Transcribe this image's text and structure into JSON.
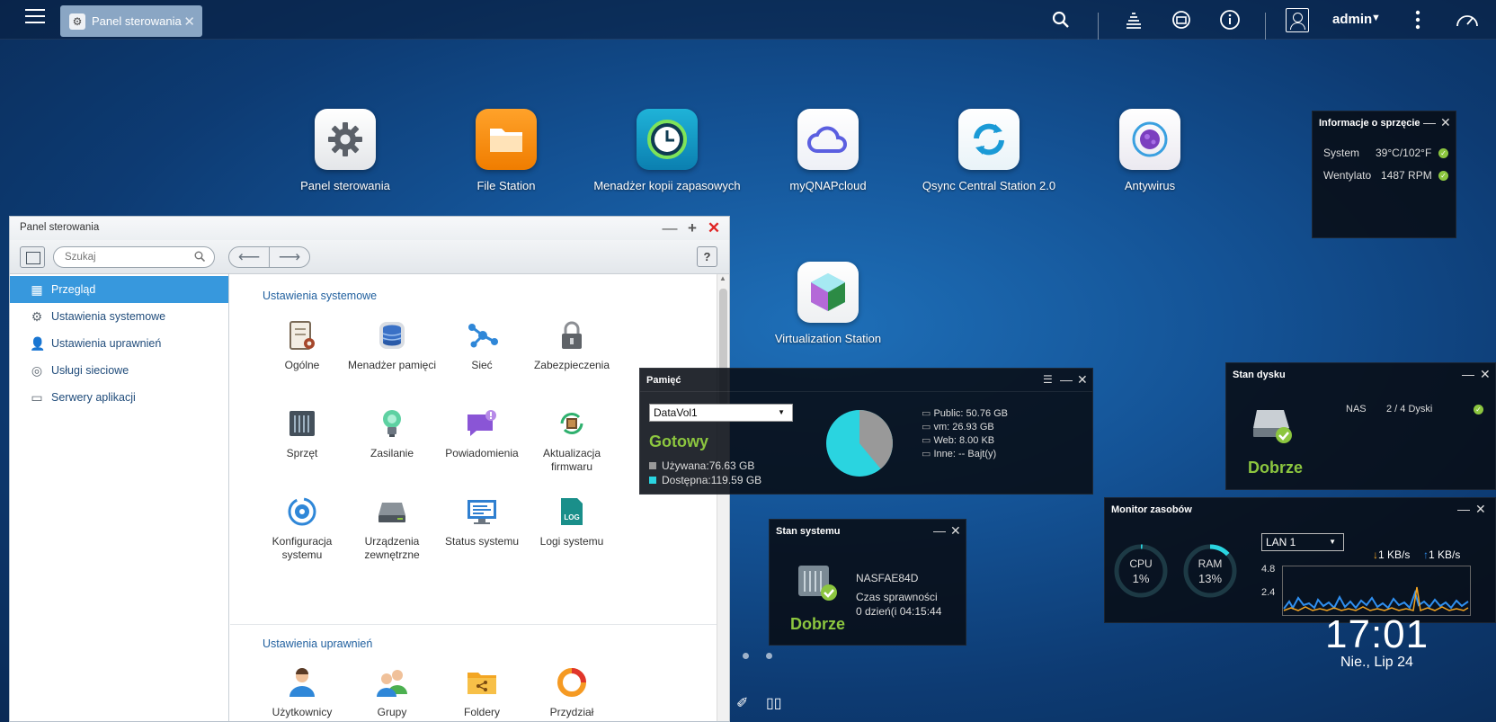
{
  "taskbar": {
    "tab_label": "Panel sterowania",
    "user": "admin"
  },
  "desktop": {
    "apps": [
      {
        "label": "Panel sterowania"
      },
      {
        "label": "File Station"
      },
      {
        "label": "Menadżer kopii zapasowych"
      },
      {
        "label": "myQNAPcloud"
      },
      {
        "label": "Qsync Central Station 2.0"
      },
      {
        "label": "Antywirus"
      },
      {
        "label": "Virtualization Station"
      }
    ]
  },
  "control_panel": {
    "title": "Panel sterowania",
    "search_placeholder": "Szukaj",
    "help": "?",
    "sidebar": [
      {
        "label": "Przegląd"
      },
      {
        "label": "Ustawienia systemowe"
      },
      {
        "label": "Ustawienia uprawnień"
      },
      {
        "label": "Usługi sieciowe"
      },
      {
        "label": "Serwery aplikacji"
      }
    ],
    "section1_title": "Ustawienia systemowe",
    "section1_items": [
      {
        "label": "Ogólne"
      },
      {
        "label": "Menadżer pamięci"
      },
      {
        "label": "Sieć"
      },
      {
        "label": "Zabezpieczenia"
      },
      {
        "label": "Sprzęt"
      },
      {
        "label": "Zasilanie"
      },
      {
        "label": "Powiadomienia"
      },
      {
        "label": "Aktualizacja firmwaru"
      },
      {
        "label": "Konfiguracja systemu"
      },
      {
        "label": "Urządzenia zewnętrzne"
      },
      {
        "label": "Status systemu"
      },
      {
        "label": "Logi systemu"
      }
    ],
    "section2_title": "Ustawienia uprawnień",
    "section2_items": [
      {
        "label": "Użytkownicy"
      },
      {
        "label": "Grupy użytkowników"
      },
      {
        "label": "Foldery współdzielone"
      },
      {
        "label": "Przydział"
      }
    ]
  },
  "hardware_widget": {
    "title": "Informacje o sprzęcie",
    "rows": [
      {
        "name": "System",
        "value": "39°C/102°F"
      },
      {
        "name": "Wentylato",
        "value": "1487 RPM"
      }
    ]
  },
  "memory_widget": {
    "title": "Pamięć",
    "volume": "DataVol1",
    "status": "Gotowy",
    "used": "Używana:76.63 GB",
    "free": "Dostępna:119.59 GB",
    "used_fraction": 0.39,
    "folders": [
      "Public: 50.76 GB",
      "vm: 26.93 GB",
      "Web: 8.00 KB",
      "Inne: -- Bajt(y)"
    ],
    "colors": {
      "used": "#999999",
      "free": "#2ad4e0"
    }
  },
  "system_widget": {
    "title": "Stan systemu",
    "status": "Dobrze",
    "hostname": "NASFAE84D",
    "uptime_label": "Czas sprawności",
    "uptime": "0 dzień(i 04:15:44"
  },
  "disk_widget": {
    "title": "Stan dysku",
    "status": "Dobrze",
    "name": "NAS",
    "disks": "2 / 4 Dyski"
  },
  "resource_widget": {
    "title": "Monitor zasobów",
    "cpu_label": "CPU",
    "cpu_value": "1%",
    "cpu_fraction": 0.01,
    "ram_label": "RAM",
    "ram_value": "13%",
    "ram_fraction": 0.13,
    "lan": "LAN 1",
    "down": "1 KB/s",
    "up": "1 KB/s",
    "y_ticks": [
      "4.8",
      "2.4"
    ]
  },
  "clock": {
    "time": "17:01",
    "date": "Nie., Lip 24"
  }
}
